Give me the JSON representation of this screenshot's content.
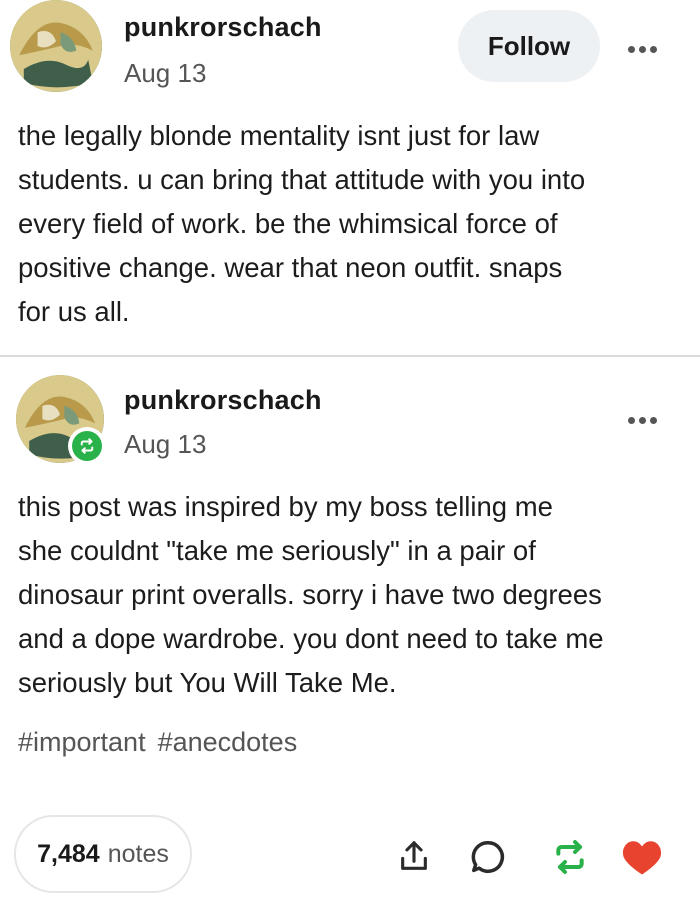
{
  "posts": [
    {
      "username": "punkrorschach",
      "date": "Aug 13",
      "follow_label": "Follow",
      "body": "the legally blonde mentality isnt just for law\nstudents. u can bring that attitude with you into\nevery field of work. be the whimsical force of\npositive change. wear that neon outfit. snaps\nfor us all."
    },
    {
      "username": "punkrorschach",
      "date": "Aug 13",
      "body": "this post was inspired by my boss telling me\nshe couldnt \"take me seriously\" in a pair of\ndinosaur print overalls. sorry i have two degrees\nand a dope wardrobe. you dont need to take me\nseriously but You Will Take Me.",
      "tags": [
        "#important",
        "#anecdotes"
      ],
      "notes_count": "7,484",
      "notes_label": "notes"
    }
  ],
  "icons": {
    "share": "share-icon",
    "reply": "reply-icon",
    "reblog": "reblog-icon",
    "like": "heart-icon",
    "more": "more-icon"
  },
  "colors": {
    "reblog_badge": "#2ab24a",
    "heart": "#e8432f",
    "follow_bg": "#eef1f4"
  }
}
